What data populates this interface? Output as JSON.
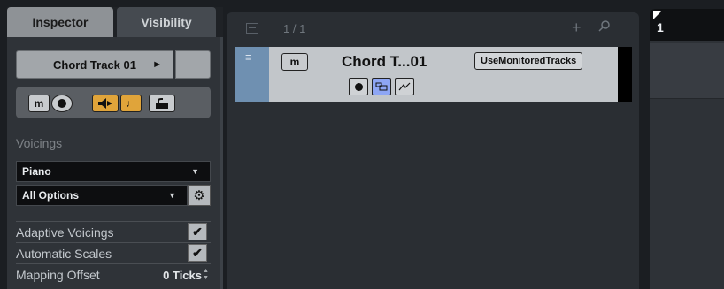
{
  "inspector": {
    "tabs": [
      {
        "label": "Inspector"
      },
      {
        "label": "Visibility"
      }
    ],
    "track_name": "Chord Track 01",
    "buttons": {
      "mute_label": "m"
    },
    "voicings_label": "Voicings",
    "voicing_dropdown": "Piano",
    "options_dropdown": "All Options",
    "options": [
      {
        "label": "Adaptive Voicings",
        "checked": true
      },
      {
        "label": "Automatic Scales",
        "checked": true
      }
    ],
    "mapping_offset": {
      "label": "Mapping Offset",
      "value": "0 Ticks"
    }
  },
  "tracklist": {
    "track_count": "1 / 1",
    "track": {
      "mute_label": "m",
      "name": "Chord T...01",
      "use_monitored_label": "UseMonitoredTracks"
    }
  },
  "arranger": {
    "bar_number": "1"
  },
  "colors": {
    "accent_orange": "#e0a43a",
    "track_strip_blue": "#6f90b1",
    "folder_button_blue": "#8ea6f4"
  }
}
